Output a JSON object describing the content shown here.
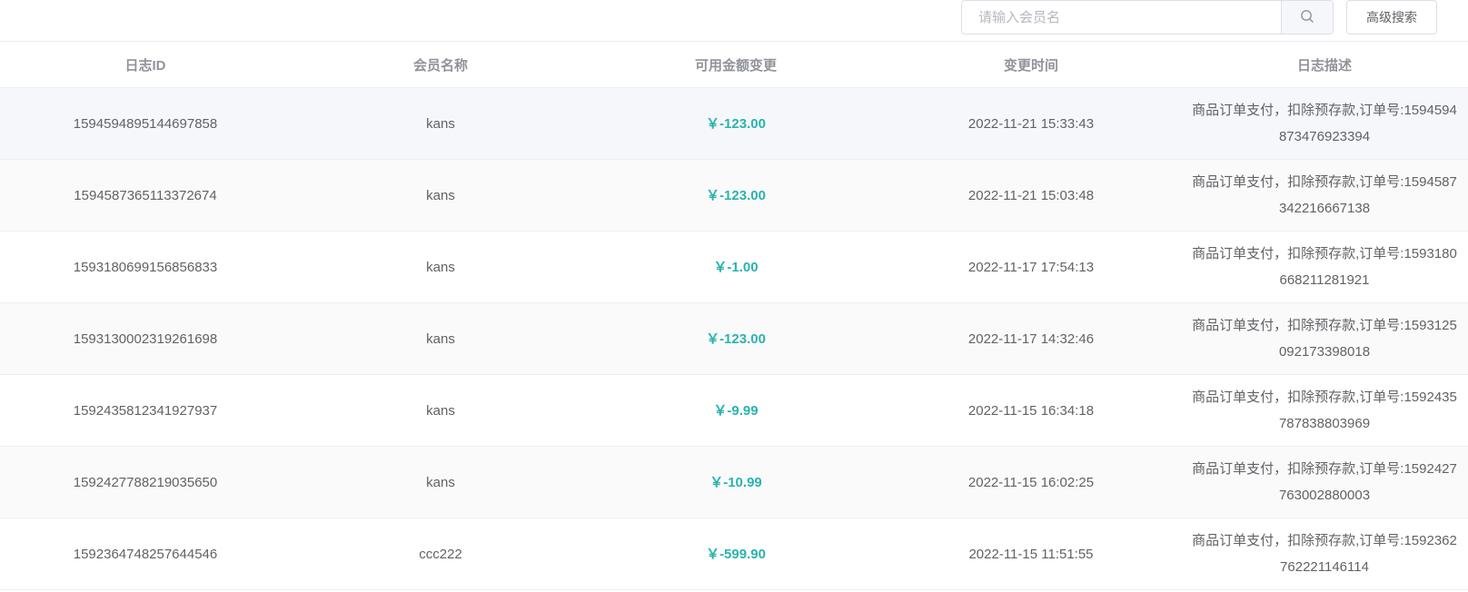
{
  "search": {
    "placeholder": "请输入会员名",
    "icon": "search-icon",
    "advanced_label": "高级搜索"
  },
  "colors": {
    "amount": "#2bb3ad",
    "header_text": "#909399",
    "border": "#ebeef5"
  },
  "table": {
    "columns": [
      "日志ID",
      "会员名称",
      "可用金额变更",
      "变更时间",
      "日志描述"
    ],
    "rows": [
      {
        "id": "1594594895144697858",
        "member": "kans",
        "amount": "￥-123.00",
        "time": "2022-11-21 15:33:43",
        "desc": "商品订单支付，扣除预存款,订单号:1594594873476923394"
      },
      {
        "id": "1594587365113372674",
        "member": "kans",
        "amount": "￥-123.00",
        "time": "2022-11-21 15:03:48",
        "desc": "商品订单支付，扣除预存款,订单号:1594587342216667138"
      },
      {
        "id": "1593180699156856833",
        "member": "kans",
        "amount": "￥-1.00",
        "time": "2022-11-17 17:54:13",
        "desc": "商品订单支付，扣除预存款,订单号:1593180668211281921"
      },
      {
        "id": "1593130002319261698",
        "member": "kans",
        "amount": "￥-123.00",
        "time": "2022-11-17 14:32:46",
        "desc": "商品订单支付，扣除预存款,订单号:1593125092173398018"
      },
      {
        "id": "1592435812341927937",
        "member": "kans",
        "amount": "￥-9.99",
        "time": "2022-11-15 16:34:18",
        "desc": "商品订单支付，扣除预存款,订单号:1592435787838803969"
      },
      {
        "id": "1592427788219035650",
        "member": "kans",
        "amount": "￥-10.99",
        "time": "2022-11-15 16:02:25",
        "desc": "商品订单支付，扣除预存款,订单号:1592427763002880003"
      },
      {
        "id": "1592364748257644546",
        "member": "ccc222",
        "amount": "￥-599.90",
        "time": "2022-11-15 11:51:55",
        "desc": "商品订单支付，扣除预存款,订单号:1592362762221146114"
      }
    ]
  }
}
